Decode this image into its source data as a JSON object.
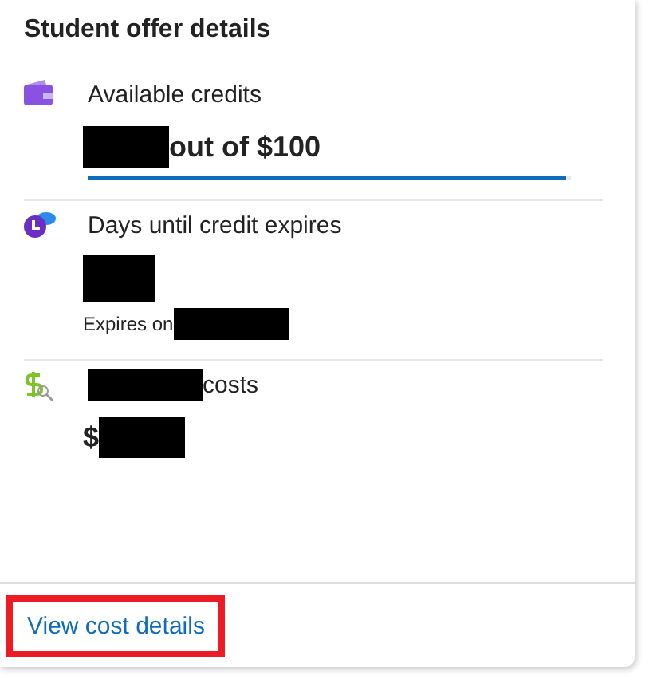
{
  "card": {
    "title": "Student offer details",
    "sections": [
      {
        "label": [
          {
            "kind": "text",
            "text": "Available credits"
          }
        ],
        "value": [
          {
            "kind": "redacted"
          },
          {
            "kind": "text",
            "text": "out of $100"
          }
        ],
        "level": 0.99
      },
      {
        "label": [
          {
            "kind": "text",
            "text": "Days until credit expires"
          }
        ],
        "value": [
          {
            "kind": "redacted"
          }
        ],
        "note": [
          {
            "kind": "text",
            "text": "Expires on"
          },
          {
            "kind": "redacted"
          }
        ]
      },
      {
        "label": [
          {
            "kind": "redacted"
          },
          {
            "kind": "text",
            "text": "costs"
          }
        ],
        "value": [
          {
            "kind": "text",
            "text": "$"
          },
          {
            "kind": "redacted"
          }
        ]
      }
    ],
    "link": {
      "text": "View cost details",
      "highlighted": true
    }
  }
}
